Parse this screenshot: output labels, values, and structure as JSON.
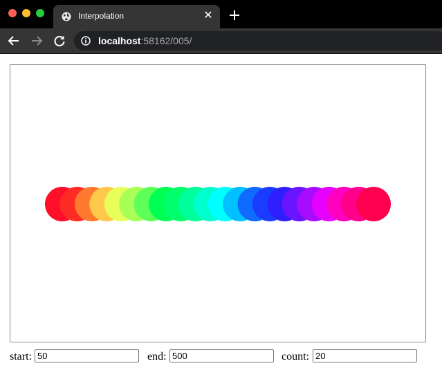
{
  "browser": {
    "tab_title": "Interpolation",
    "url_host": "localhost",
    "url_rest": ":58162/005/"
  },
  "icons": {
    "tab": "globe-icon",
    "new_tab": "plus-icon",
    "back": "arrow-left-icon",
    "forward": "arrow-right-icon",
    "reload": "reload-icon",
    "site_info": "info-icon"
  },
  "controls": {
    "start_label": "start:",
    "start_value": "50",
    "end_label": "end:",
    "end_value": "500",
    "count_label": "count:",
    "count_value": "20"
  },
  "circles": {
    "start": 50,
    "end": 500,
    "count": 20,
    "colors": [
      "#ff0f2a",
      "#ff2c26",
      "#ff7a2e",
      "#ffc84a",
      "#e8ff5a",
      "#a8ff56",
      "#5dff58",
      "#00ff55",
      "#00ff6d",
      "#00ff9a",
      "#00ffcf",
      "#00ffff",
      "#00c0ff",
      "#0f6bff",
      "#1a3cff",
      "#2e1fff",
      "#6a14ff",
      "#a80cff",
      "#e600ff",
      "#ff00bf",
      "#ff008b",
      "#ff0050"
    ]
  }
}
